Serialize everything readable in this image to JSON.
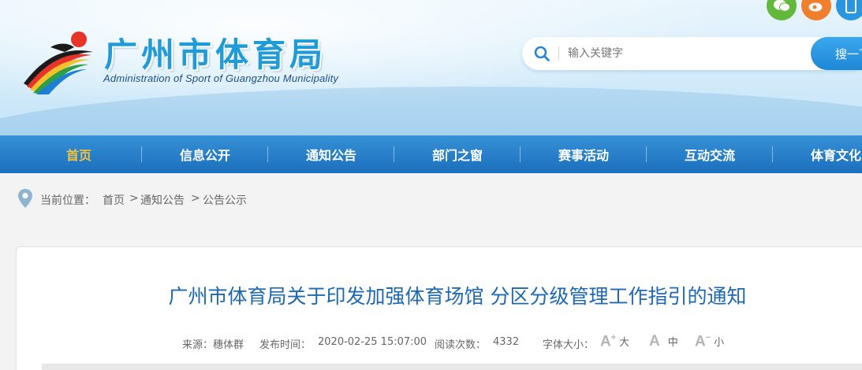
{
  "header": {
    "title": "广州市体育局",
    "subtitle": "Administration of Sport of Guangzhou Municipality",
    "social": [
      "wechat-icon",
      "weibo-icon",
      "mobile-icon"
    ]
  },
  "search": {
    "placeholder": "输入关键字",
    "button_label": "搜一下"
  },
  "nav": {
    "items": [
      {
        "label": "首页",
        "active": true
      },
      {
        "label": "信息公开"
      },
      {
        "label": "通知公告"
      },
      {
        "label": "部门之窗"
      },
      {
        "label": "赛事活动"
      },
      {
        "label": "互动交流"
      },
      {
        "label": "体育文化"
      }
    ]
  },
  "breadcrumb": {
    "prefix": "当前位置：",
    "items": [
      "首页",
      "通知公告",
      "公告公示"
    ],
    "separator": ">"
  },
  "article": {
    "title": "广州市体育局关于印发加强体育场馆 分区分级管理工作指引的通知",
    "source_label": "来源：",
    "source": "穗体群",
    "time_label": "发布时间：",
    "time": "2020-02-25 15:07:00",
    "views_label": "阅读次数：",
    "views": "4332",
    "font_size_label": "字体大小：",
    "font_sizes": [
      {
        "glyph": "A",
        "mark": "+",
        "label": "大"
      },
      {
        "glyph": "A",
        "mark": "",
        "label": "中"
      },
      {
        "glyph": "A",
        "mark": "−",
        "label": "小"
      }
    ]
  },
  "colors": {
    "brand_blue": "#1f9bd7",
    "nav_blue": "#2a7fcb",
    "nav_active": "#f5c23c",
    "title_blue": "#1d68b4"
  }
}
